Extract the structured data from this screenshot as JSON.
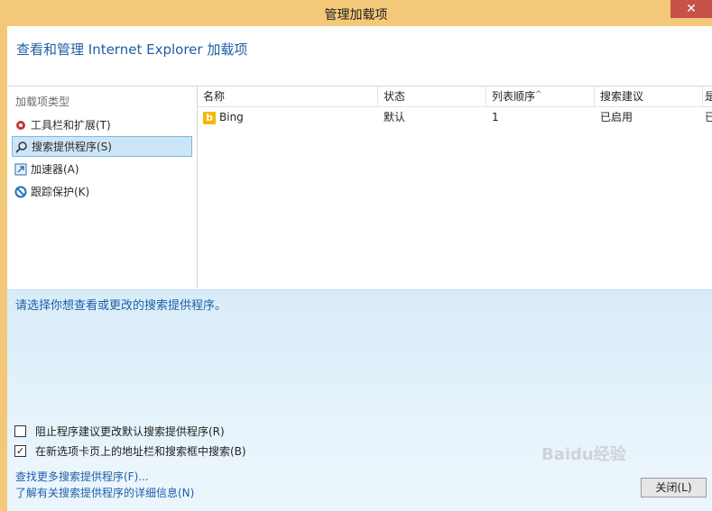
{
  "window": {
    "title": "管理加载项"
  },
  "header": {
    "title": "查看和管理 Internet Explorer 加载项"
  },
  "left_panel": {
    "label": "加载项类型",
    "items": [
      {
        "label": "工具栏和扩展(T)",
        "icon": "gear-icon"
      },
      {
        "label": "搜索提供程序(S)",
        "icon": "search-icon",
        "selected": true
      },
      {
        "label": "加速器(A)",
        "icon": "accelerator-icon"
      },
      {
        "label": "跟踪保护(K)",
        "icon": "block-icon"
      }
    ]
  },
  "table": {
    "columns": [
      "名称",
      "状态",
      "列表顺序",
      "搜索建议",
      "是"
    ],
    "rows": [
      {
        "name": "Bing",
        "status": "默认",
        "order": "1",
        "suggest": "已启用",
        "extra": "已"
      }
    ]
  },
  "detail": {
    "message": "请选择你想查看或更改的搜索提供程序。",
    "checkbox1": {
      "label": "阻止程序建议更改默认搜索提供程序(R)",
      "checked": false
    },
    "checkbox2": {
      "label": "在新选项卡页上的地址栏和搜索框中搜索(B)",
      "checked": true
    }
  },
  "footer": {
    "link1": "查找更多搜索提供程序(F)...",
    "link2": "了解有关搜索提供程序的详细信息(N)",
    "close_label": "关闭(L)"
  },
  "watermark": "Baidu经验",
  "colors": {
    "titlebar": "#f3c979",
    "accent": "#1f5fa8",
    "selection": "#cde6f7",
    "close": "#c7524a"
  }
}
